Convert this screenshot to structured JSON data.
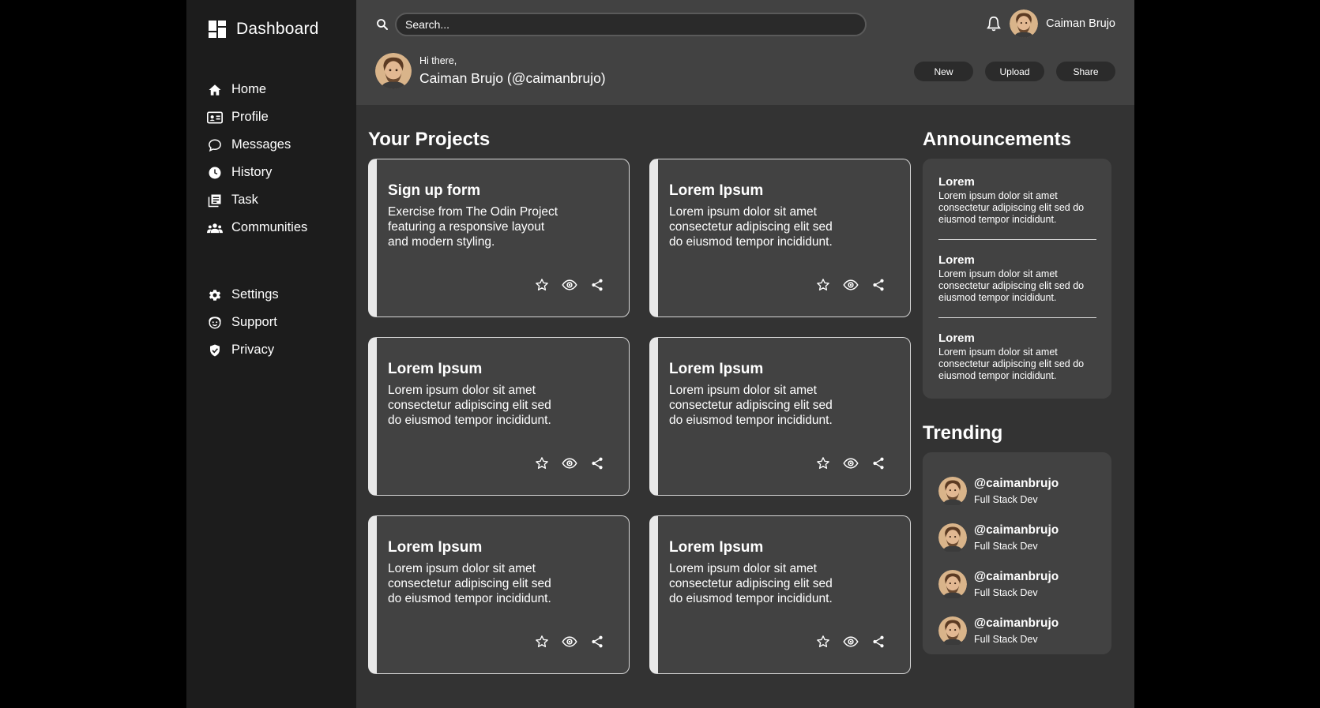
{
  "sidebar": {
    "brand": "Dashboard",
    "nav_primary": [
      {
        "label": "Home",
        "icon": "home-icon"
      },
      {
        "label": "Profile",
        "icon": "profile-card-icon"
      },
      {
        "label": "Messages",
        "icon": "chat-bubble-icon"
      },
      {
        "label": "History",
        "icon": "clock-icon"
      },
      {
        "label": "Task",
        "icon": "task-list-icon"
      },
      {
        "label": "Communities",
        "icon": "people-group-icon"
      }
    ],
    "nav_secondary": [
      {
        "label": "Settings",
        "icon": "gear-icon"
      },
      {
        "label": "Support",
        "icon": "support-icon"
      },
      {
        "label": "Privacy",
        "icon": "shield-check-icon"
      }
    ]
  },
  "header": {
    "search_placeholder": "Search...",
    "user_name": "Caiman Brujo",
    "greeting": "Hi there,",
    "full_name": "Caiman Brujo (@caimanbrujo)",
    "actions": {
      "new": "New",
      "upload": "Upload",
      "share": "Share"
    }
  },
  "projects": {
    "title": "Your Projects",
    "cards": [
      {
        "title": "Sign up form",
        "desc": "Exercise from The Odin Project featuring a responsive layout and modern styling."
      },
      {
        "title": "Lorem Ipsum",
        "desc": "Lorem ipsum dolor sit amet consectetur adipiscing elit sed do eiusmod tempor incididunt."
      },
      {
        "title": "Lorem Ipsum",
        "desc": "Lorem ipsum dolor sit amet consectetur adipiscing elit sed do eiusmod tempor incididunt."
      },
      {
        "title": "Lorem Ipsum",
        "desc": "Lorem ipsum dolor sit amet consectetur adipiscing elit sed do eiusmod tempor incididunt."
      },
      {
        "title": "Lorem Ipsum",
        "desc": "Lorem ipsum dolor sit amet consectetur adipiscing elit sed do eiusmod tempor incididunt."
      },
      {
        "title": "Lorem Ipsum",
        "desc": "Lorem ipsum dolor sit amet consectetur adipiscing elit sed do eiusmod tempor incididunt."
      }
    ]
  },
  "announcements": {
    "title": "Announcements",
    "items": [
      {
        "head": "Lorem",
        "text": "Lorem ipsum dolor sit amet consectetur adipiscing elit sed do eiusmod tempor incididunt."
      },
      {
        "head": "Lorem",
        "text": "Lorem ipsum dolor sit amet consectetur adipiscing elit sed do eiusmod tempor incididunt."
      },
      {
        "head": "Lorem",
        "text": "Lorem ipsum dolor sit amet consectetur adipiscing elit sed do eiusmod tempor incididunt."
      }
    ]
  },
  "trending": {
    "title": "Trending",
    "items": [
      {
        "handle": "@caimanbrujo",
        "role": "Full Stack Dev"
      },
      {
        "handle": "@caimanbrujo",
        "role": "Full Stack Dev"
      },
      {
        "handle": "@caimanbrujo",
        "role": "Full Stack Dev"
      },
      {
        "handle": "@caimanbrujo",
        "role": "Full Stack Dev"
      }
    ]
  },
  "colors": {
    "sidebar_bg": "#1c1c1c",
    "main_bg": "#333333",
    "header_bg": "#424242",
    "card_bg": "#424242",
    "card_accent": "#e8e8e8",
    "text": "#ffffff"
  }
}
